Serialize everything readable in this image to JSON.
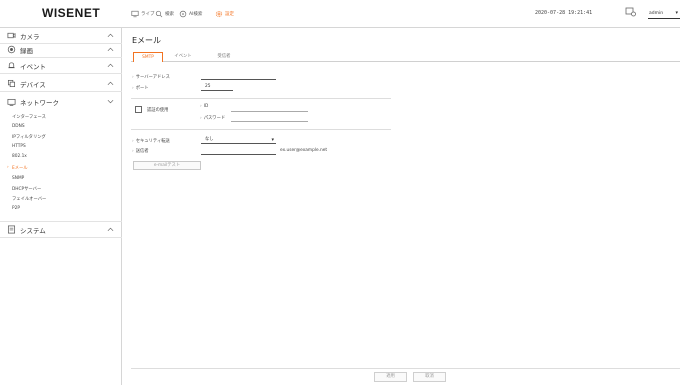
{
  "app": {
    "logo": "WISENET"
  },
  "topnav": [
    {
      "label": "ライブ",
      "icon": "monitor-icon"
    },
    {
      "label": "検索",
      "icon": "search-icon"
    },
    {
      "label": "AI検索",
      "icon": "ai-search-icon"
    },
    {
      "label": "設定",
      "icon": "gear-icon",
      "active": true
    }
  ],
  "header": {
    "datetime": "2020-07-28 19:21:41",
    "user": "admin"
  },
  "sidebar": {
    "sections": [
      {
        "label": "カメラ",
        "icon": "camera-icon",
        "expanded": false
      },
      {
        "label": "録画",
        "icon": "record-icon",
        "expanded": false
      },
      {
        "label": "イベント",
        "icon": "bell-icon",
        "expanded": false
      },
      {
        "label": "デバイス",
        "icon": "device-icon",
        "expanded": false
      },
      {
        "label": "ネットワーク",
        "icon": "network-icon",
        "expanded": true
      },
      {
        "label": "システム",
        "icon": "system-icon",
        "expanded": false
      }
    ],
    "network_items": [
      "インターフェース",
      "DDNS",
      "IPフィルタリング",
      "HTTPS",
      "802.1x",
      "Eメール",
      "SNMP",
      "DHCPサーバー",
      "フェイルオーバー",
      "P2P"
    ],
    "active_item": "Eメール"
  },
  "main": {
    "title": "Eメール",
    "tabs": [
      "SMTP",
      "イベント",
      "受信者"
    ],
    "active_tab": "SMTP",
    "server_label": "サーバーアドレス",
    "server_value": "",
    "port_label": "ポート",
    "port_value": "25",
    "auth_label": "認証の使用",
    "auth_checked": false,
    "id_label": "ID",
    "id_value": "",
    "password_label": "パスワード",
    "password_value": "",
    "security_label": "セキュリティ転送",
    "security_value": "なし",
    "sender_label": "送信者",
    "sender_value": "",
    "sender_hint": "ex.user@example.net",
    "test_button": "e-mailテスト",
    "apply_button": "適用",
    "cancel_button": "取消"
  },
  "colors": {
    "accent": "#f37321"
  }
}
